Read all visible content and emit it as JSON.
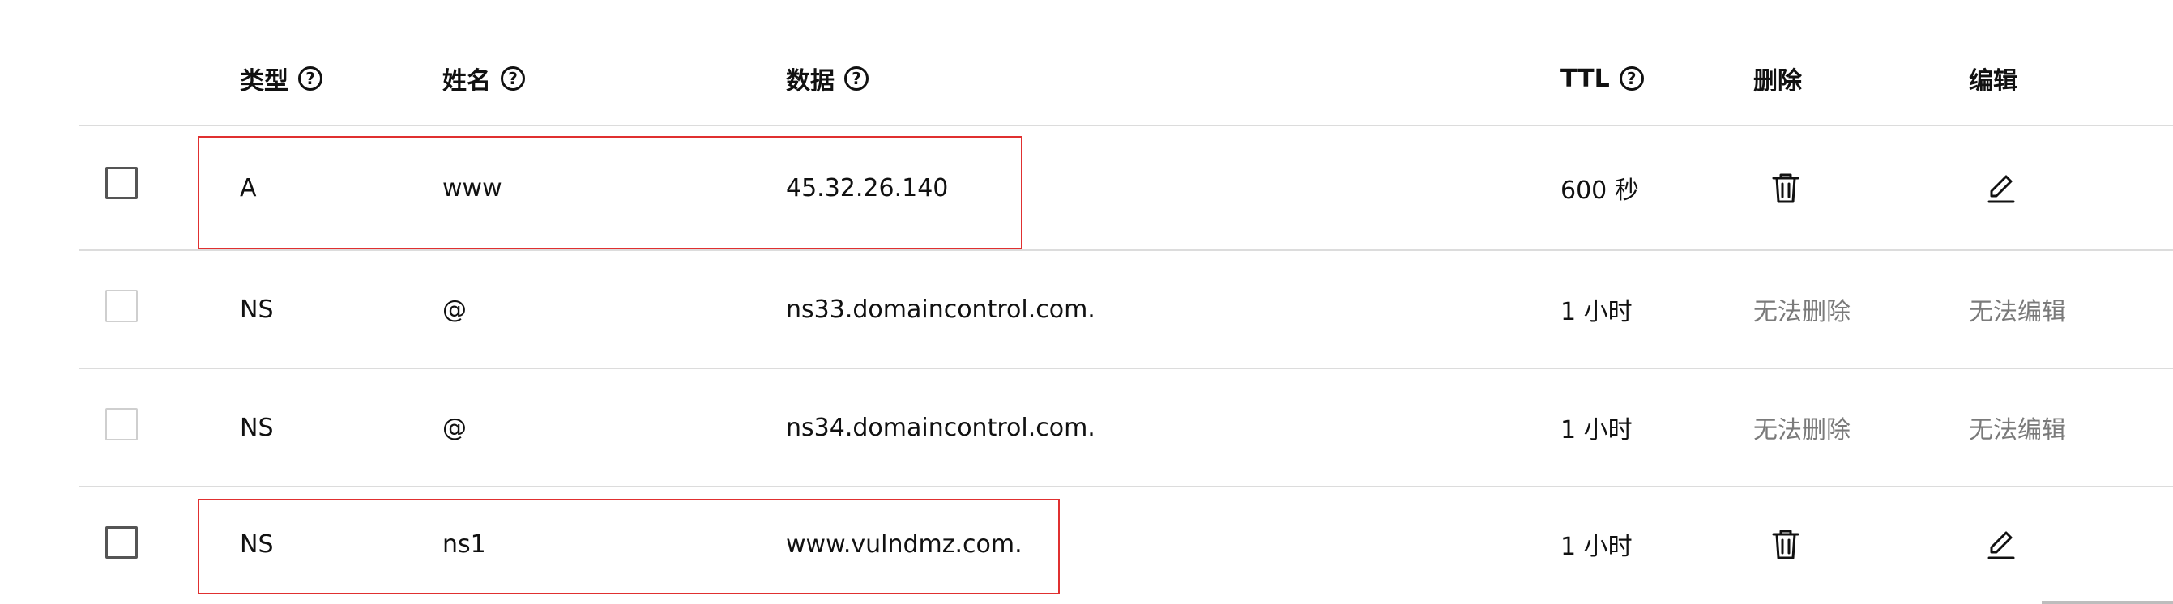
{
  "table": {
    "headers": {
      "type": "类型",
      "name": "姓名",
      "data": "数据",
      "ttl": "TTL",
      "delete": "删除",
      "edit": "编辑"
    },
    "rows": [
      {
        "type": "A",
        "name": "www",
        "data": "45.32.26.140",
        "ttl": "600 秒",
        "delete": "trash-icon",
        "edit": "pencil-icon",
        "checkbox_enabled": true,
        "highlighted": true
      },
      {
        "type": "NS",
        "name": "@",
        "data": "ns33.domaincontrol.com.",
        "ttl": "1 小时",
        "delete": "无法删除",
        "edit": "无法编辑",
        "checkbox_enabled": false,
        "highlighted": false
      },
      {
        "type": "NS",
        "name": "@",
        "data": "ns34.domaincontrol.com.",
        "ttl": "1 小时",
        "delete": "无法删除",
        "edit": "无法编辑",
        "checkbox_enabled": false,
        "highlighted": false
      },
      {
        "type": "NS",
        "name": "ns1",
        "data": "www.vulndmz.com.",
        "ttl": "1 小时",
        "delete": "trash-icon",
        "edit": "pencil-icon",
        "checkbox_enabled": true,
        "highlighted": true
      }
    ]
  },
  "help_glyph": "?",
  "colors": {
    "highlight": "#e03030",
    "divider": "#dcdcdc",
    "disabled_text": "#7a7a7a",
    "text": "#111111"
  }
}
